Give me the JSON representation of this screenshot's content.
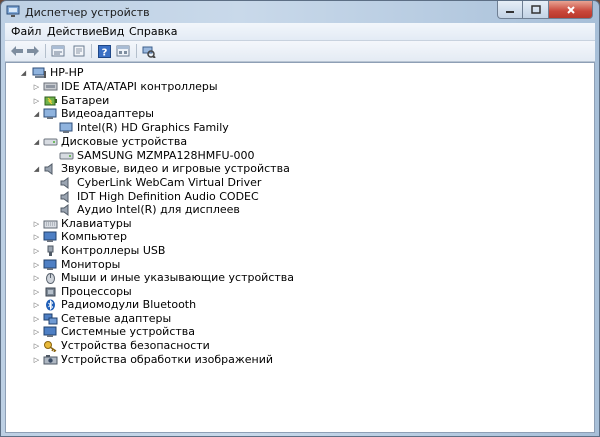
{
  "window": {
    "title": "Диспетчер устройств"
  },
  "menu": [
    "Файл",
    "Действие",
    "Вид",
    "Справка"
  ],
  "toolbar": [
    "back-arrow-icon",
    "forward-arrow-icon",
    "properties-icon",
    "update-driver-icon",
    "help-icon",
    "view-icon",
    "scan-hardware-icon"
  ],
  "tree": {
    "root": "HP-HP",
    "categories": [
      {
        "label": "IDE ATA/ATAPI контроллеры",
        "icon": "ide-controller-icon"
      },
      {
        "label": "Батареи",
        "icon": "battery-icon"
      },
      {
        "label": "Видеоадаптеры",
        "icon": "display-adapter-icon",
        "children": [
          {
            "label": "Intel(R) HD Graphics Family",
            "icon": "display-adapter-icon"
          }
        ]
      },
      {
        "label": "Дисковые устройства",
        "icon": "disk-drive-icon",
        "children": [
          {
            "label": "SAMSUNG MZMPA128HMFU-000",
            "icon": "disk-drive-icon"
          }
        ]
      },
      {
        "label": "Звуковые, видео и игровые устройства",
        "icon": "speaker-icon",
        "children": [
          {
            "label": "CyberLink WebCam Virtual Driver",
            "icon": "speaker-icon"
          },
          {
            "label": "IDT High Definition Audio CODEC",
            "icon": "speaker-icon"
          },
          {
            "label": "Аудио Intel(R) для дисплеев",
            "icon": "speaker-icon"
          }
        ]
      },
      {
        "label": "Клавиатуры",
        "icon": "keyboard-icon"
      },
      {
        "label": "Компьютер",
        "icon": "monitor-icon"
      },
      {
        "label": "Контроллеры USB",
        "icon": "usb-icon"
      },
      {
        "label": "Мониторы",
        "icon": "monitor-icon"
      },
      {
        "label": "Мыши и иные указывающие устройства",
        "icon": "mouse-icon"
      },
      {
        "label": "Процессоры",
        "icon": "processor-icon"
      },
      {
        "label": "Радиомодули Bluetooth",
        "icon": "bluetooth-icon"
      },
      {
        "label": "Сетевые адаптеры",
        "icon": "network-adapter-icon"
      },
      {
        "label": "Системные устройства",
        "icon": "monitor-icon"
      },
      {
        "label": "Устройства безопасности",
        "icon": "security-key-icon"
      },
      {
        "label": "Устройства обработки изображений",
        "icon": "imaging-device-icon"
      }
    ]
  },
  "colors": {
    "accent": "#2b62b8",
    "window_frame": "#c4d5e8",
    "close_red": "#c9473a"
  }
}
